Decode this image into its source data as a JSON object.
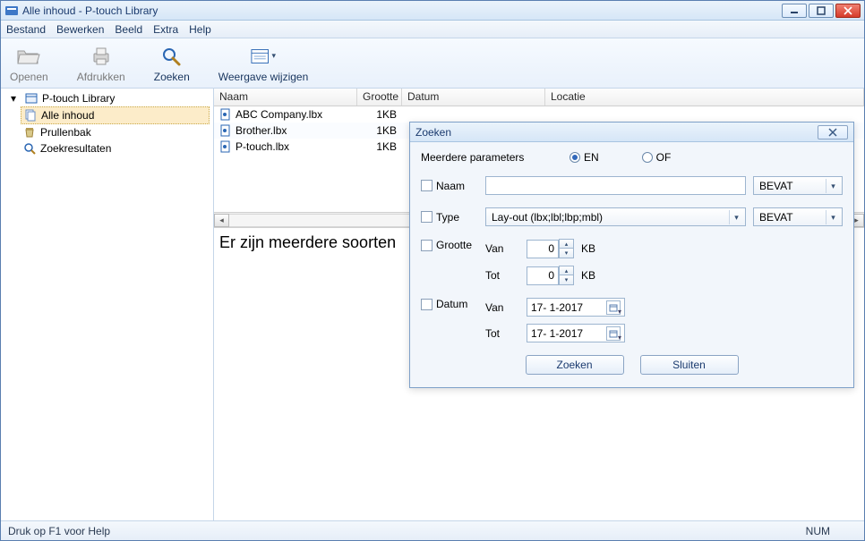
{
  "window": {
    "title": "Alle inhoud - P-touch Library"
  },
  "menu": {
    "file": "Bestand",
    "edit": "Bewerken",
    "view": "Beeld",
    "extra": "Extra",
    "help": "Help"
  },
  "toolbar": {
    "open": "Openen",
    "print": "Afdrukken",
    "search": "Zoeken",
    "display": "Weergave wijzigen"
  },
  "tree": {
    "root": "P-touch Library",
    "items": [
      {
        "label": "Alle inhoud",
        "icon": "doc-stack",
        "selected": true
      },
      {
        "label": "Prullenbak",
        "icon": "trash",
        "selected": false
      },
      {
        "label": "Zoekresultaten",
        "icon": "search",
        "selected": false
      }
    ]
  },
  "columns": {
    "name": "Naam",
    "size": "Grootte",
    "date": "Datum",
    "location": "Locatie"
  },
  "rows": [
    {
      "name": "ABC Company.lbx",
      "size": "1KB"
    },
    {
      "name": "Brother.lbx",
      "size": "1KB"
    },
    {
      "name": "P-touch.lbx",
      "size": "1KB"
    }
  ],
  "preview": {
    "text": "Er zijn meerdere soorten"
  },
  "status": {
    "help": "Druk op F1 voor Help",
    "num": "NUM"
  },
  "dialog": {
    "title": "Zoeken",
    "multi_label": "Meerdere parameters",
    "and": "EN",
    "or": "OF",
    "name_label": "Naam",
    "type_label": "Type",
    "type_value": "Lay-out (lbx;lbl;lbp;mbl)",
    "size_label": "Grootte",
    "date_label": "Datum",
    "from": "Van",
    "to": "Tot",
    "size_from": "0",
    "size_to": "0",
    "kb": "KB",
    "date_from": "17-  1-2017",
    "date_to": "17-  1-2017",
    "contains": "BEVAT",
    "search_btn": "Zoeken",
    "close_btn": "Sluiten"
  }
}
